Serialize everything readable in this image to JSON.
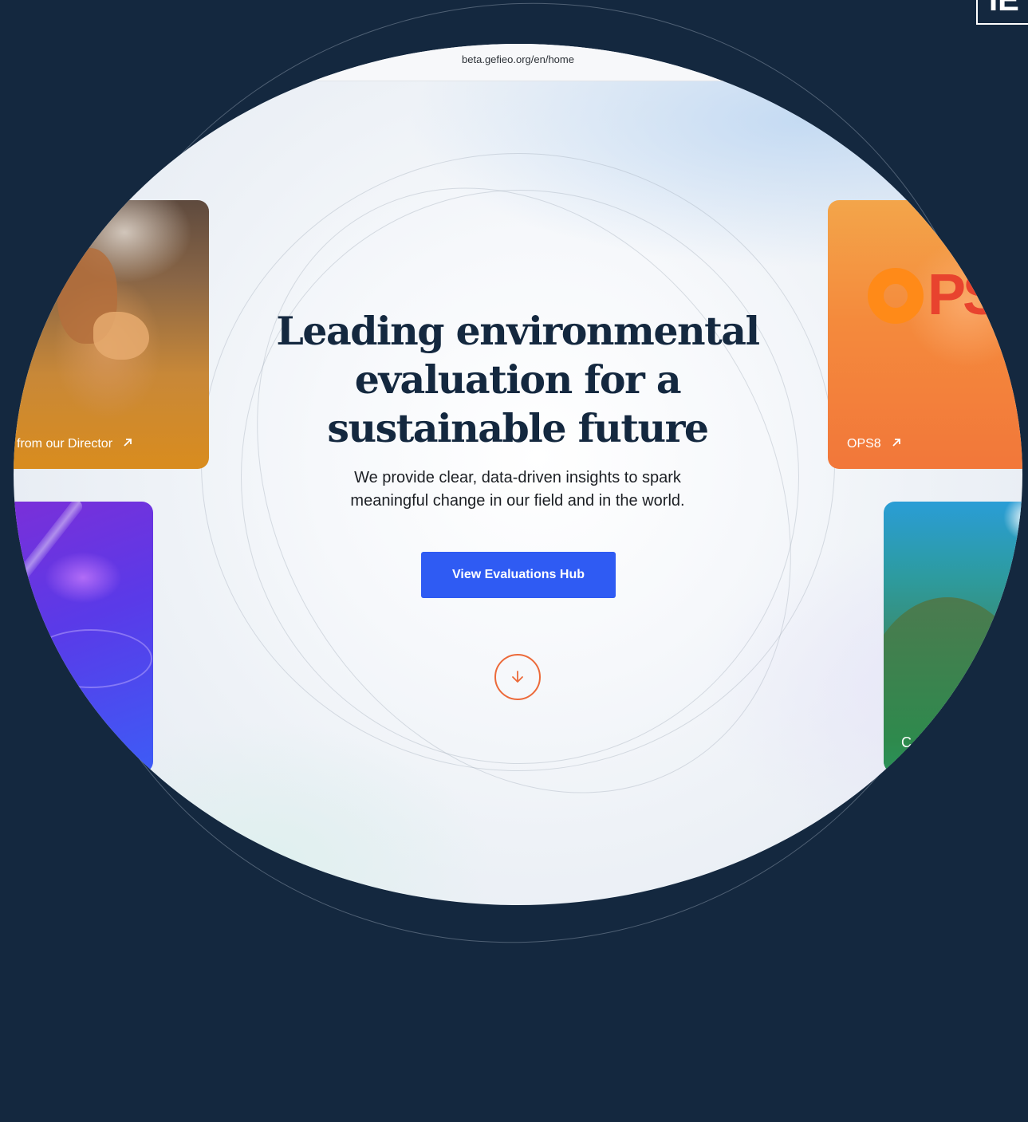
{
  "browser": {
    "url": "beta.gefieo.org/en/home"
  },
  "corner_logo": {
    "text": "IE"
  },
  "hero": {
    "title": "Leading environmental evaluation for a sustainable future",
    "subtitle": "We provide clear, data-driven insights to spark meaningful change in our field and in the world.",
    "cta_label": "View Evaluations Hub"
  },
  "cards": {
    "director": {
      "label": "from our Director",
      "icon": "arrow-up-right-icon"
    },
    "ops": {
      "label": "OPS8",
      "icon": "arrow-up-right-icon",
      "image_text": "OPS"
    },
    "science": {
      "label": ""
    },
    "landscape": {
      "label": "C"
    }
  },
  "scroll": {
    "icon": "arrow-down-icon"
  },
  "colors": {
    "background": "#14283f",
    "title": "#14283f",
    "cta": "#2f5bf3",
    "scroll_accent": "#ec6a3a"
  }
}
